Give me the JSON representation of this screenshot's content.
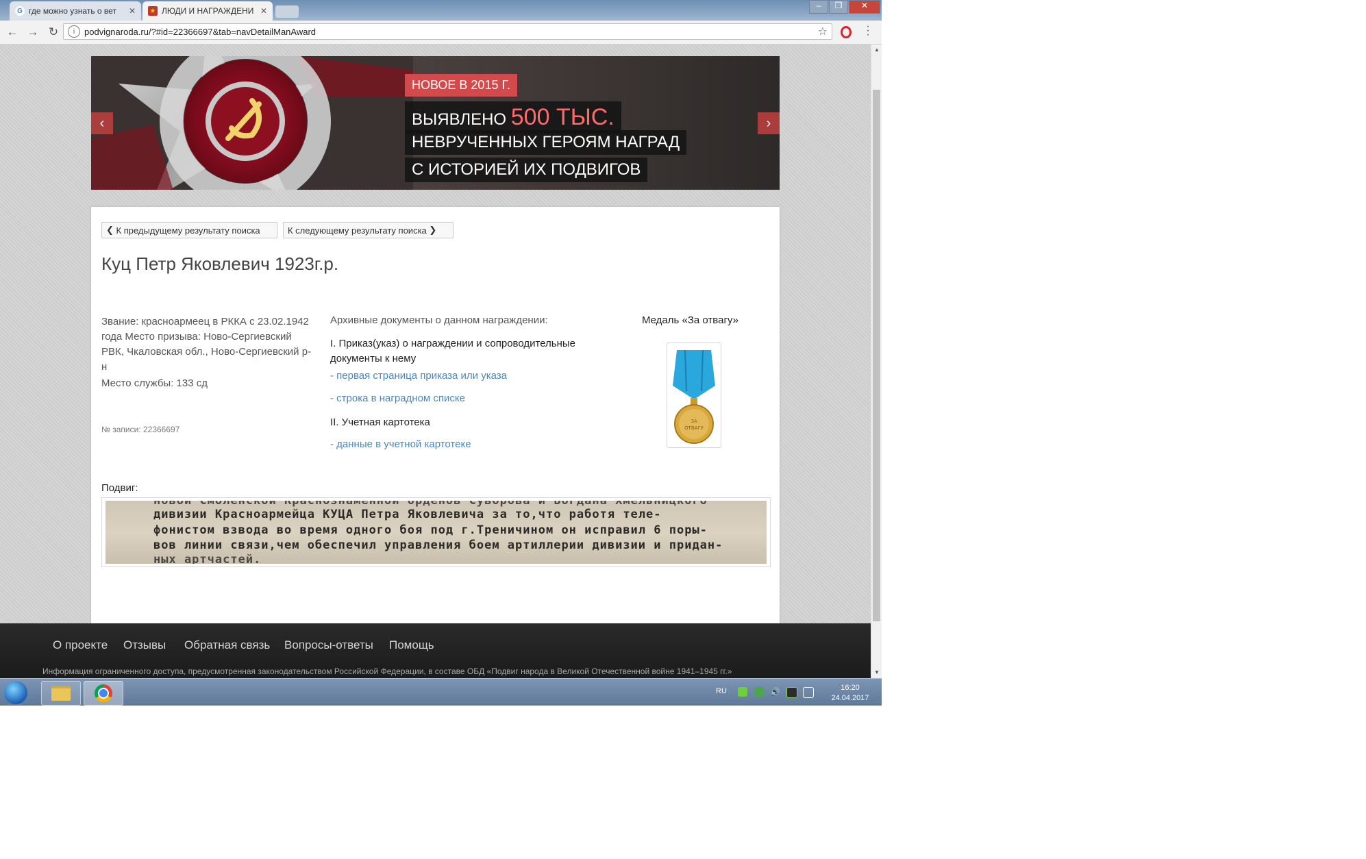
{
  "browser": {
    "tabs": [
      {
        "title": "где можно узнать о вет",
        "favicon": "google-g"
      },
      {
        "title": "ЛЮДИ И НАГРАЖДЕНИ",
        "favicon": "podvig-star"
      }
    ],
    "url": "podvignaroda.ru/?#id=22366697&tab=navDetailManAward",
    "url_info_glyph": "i",
    "window_controls": {
      "minimize": "–",
      "restore": "❐",
      "close": "✕"
    }
  },
  "banner": {
    "badge": "НОВОЕ В 2015 Г.",
    "line1_prefix": "ВЫЯВЛЕНО ",
    "line1_highlight": "500 ТЫС.",
    "line2": "НЕВРУЧЕННЫХ ГЕРОЯМ НАГРАД",
    "line3": "С ИСТОРИЕЙ ИХ ПОДВИГОВ",
    "arrow_left": "‹",
    "arrow_right": "›",
    "accent": "#d34a4d"
  },
  "pager": {
    "prev_label": "К предыдущему результату поиска",
    "next_label": "К следующему результату поиска"
  },
  "person": {
    "name": "Куц Петр Яковлевич 1923г.р.",
    "rank_text": "Звание: красноармеец в РККА с 23.02.1942 года Место призыва: Ново-Сергиевский РВК, Чкаловская обл., Ново-Сергиевский р-н",
    "service_text": "Место службы: 133 сд",
    "record_no": "№ записи: 22366697"
  },
  "documents": {
    "title": "Архивные документы о данном награждении:",
    "section1": "I. Приказ(указ) о награждении и сопроводительные документы к нему",
    "link1": "- первая страница приказа или указа",
    "link2": "- строка в наградном списке",
    "section2": "II. Учетная картотека",
    "link3": "- данные в учетной картотеке",
    "link_color": "#4a86c0"
  },
  "award": {
    "title": "Медаль «За отвагу»"
  },
  "feat": {
    "label": "Подвиг:",
    "scan_lines": [
      "новой Смоленской Краснознаменной орденов Суворова и Богдана Хмельницкого",
      "дивизии Красноармейца КУЦА Петра Яковлевича за то,что работя теле-",
      "фонистом взвода во время одного боя под г.Треничином он исправил 6 поры-",
      "вов линии связи,чем обеспечил управления боем артиллерии дивизии и придан-",
      "ных артчастей."
    ]
  },
  "footer": {
    "nav": [
      "О проекте",
      "Отзывы",
      "Обратная связь",
      "Вопросы-ответы",
      "Помощь"
    ],
    "info": "Информация ограниченного доступа, предусмотренная законодательством Российской Федерации, в составе ОБД «Подвиг народа в Великой Отечественной войне 1941–1945 гг.»"
  },
  "taskbar": {
    "lang": "RU",
    "time": "16:20",
    "date": "24.04.2017",
    "volume_glyph": "🔊"
  }
}
